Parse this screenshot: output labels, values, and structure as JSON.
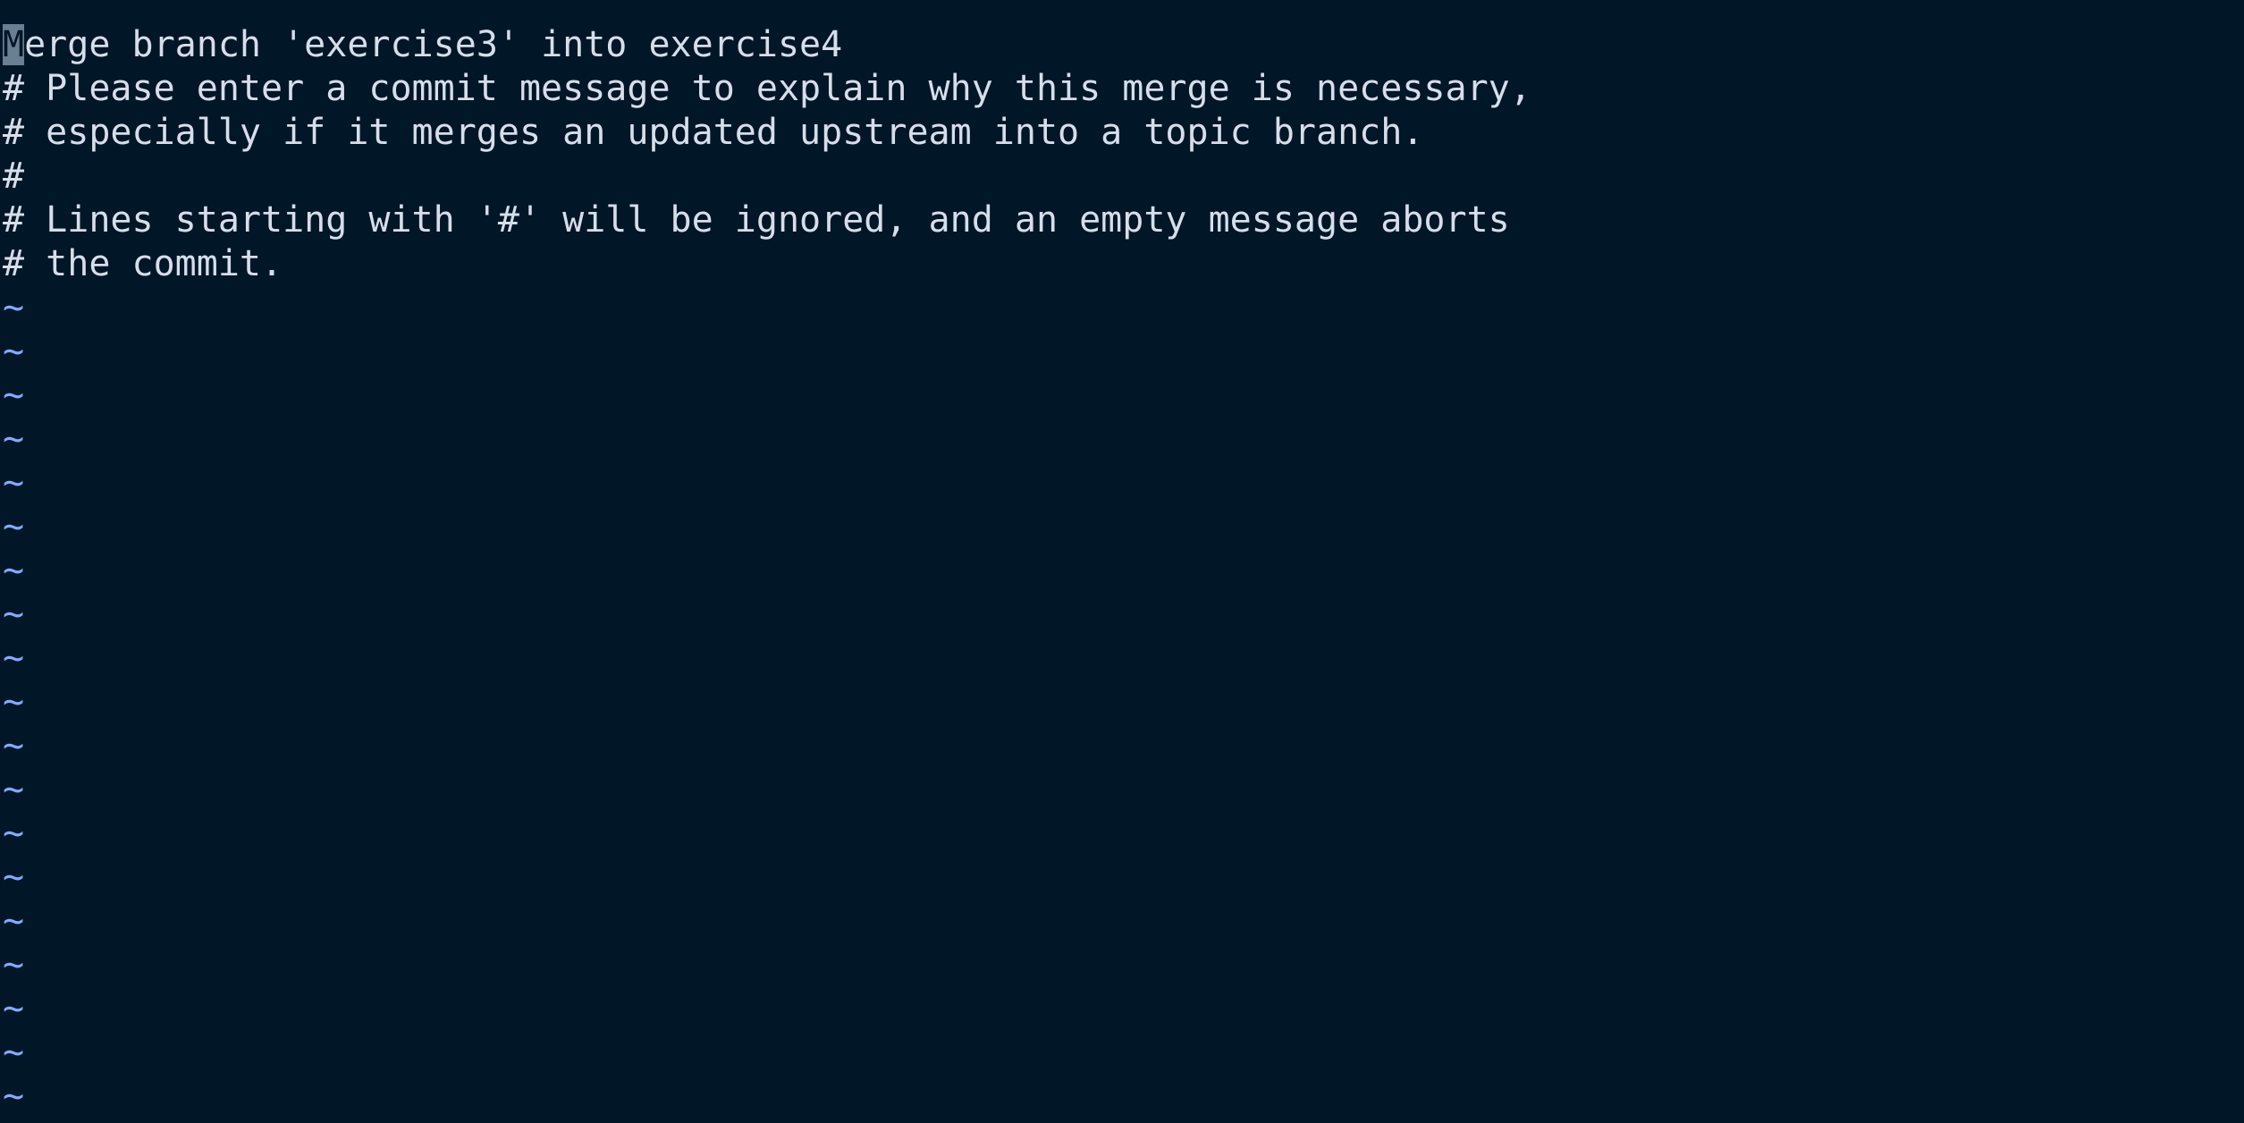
{
  "editor": {
    "cursor_char": "M",
    "first_line_rest": "erge branch 'exercise3' into exercise4",
    "comment_lines": [
      "# Please enter a commit message to explain why this merge is necessary,",
      "# especially if it merges an updated upstream into a topic branch.",
      "#",
      "# Lines starting with '#' will be ignored, and an empty message aborts",
      "# the commit."
    ],
    "empty_line_marker": "~",
    "colors": {
      "background": "#011627",
      "text": "#d6deeb",
      "tilde": "#82aaff",
      "cursor": "#6b7f92"
    }
  }
}
